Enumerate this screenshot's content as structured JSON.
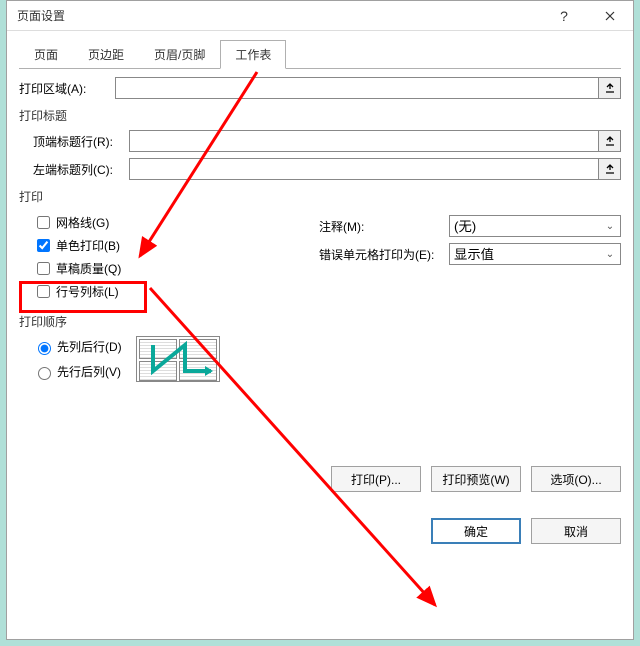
{
  "window": {
    "title": "页面设置"
  },
  "tabs": {
    "page": "页面",
    "margins": "页边距",
    "header_footer": "页眉/页脚",
    "sheet": "工作表"
  },
  "labels": {
    "print_area": "打印区域(A):",
    "print_titles": "打印标题",
    "rows_repeat": "顶端标题行(R):",
    "cols_repeat": "左端标题列(C):",
    "print_section": "打印",
    "gridlines": "网格线(G)",
    "black_white": "单色打印(B)",
    "draft": "草稿质量(Q)",
    "row_col_headings": "行号列标(L)",
    "comments": "注释(M):",
    "cell_errors": "错误单元格打印为(E):",
    "page_order": "打印顺序",
    "down_then_over": "先列后行(D)",
    "over_then_down": "先行后列(V)"
  },
  "values": {
    "print_area": "",
    "rows_repeat": "",
    "cols_repeat": "",
    "comments_selected": "(无)",
    "cell_errors_selected": "显示值",
    "gridlines_checked": false,
    "black_white_checked": true,
    "draft_checked": false,
    "row_col_checked": false,
    "order_selected": "down_then_over"
  },
  "buttons": {
    "print": "打印(P)...",
    "preview": "打印预览(W)",
    "options": "选项(O)...",
    "ok": "确定",
    "cancel": "取消"
  }
}
